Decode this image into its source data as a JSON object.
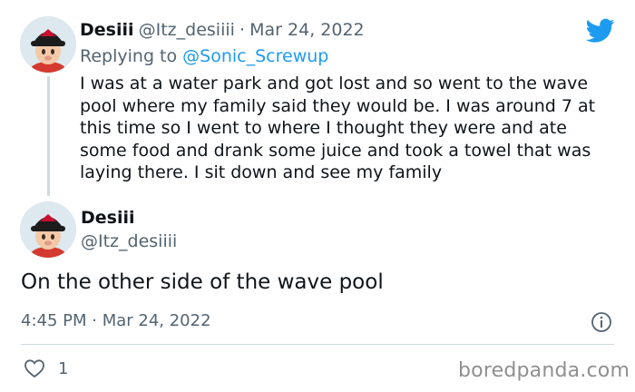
{
  "reply_tweet": {
    "display_name": "Desiii",
    "handle": "@Itz_desiiii",
    "separator": "·",
    "date": "Mar 24, 2022",
    "replying_prefix": "Replying to",
    "replying_to": "@Sonic_Screwup",
    "text": "I was at a water park and got lost and so went to the wave pool where my family said they would be. I was around 7 at this time so I went to where I thought they were and ate some food and drank some juice and took a towel that was laying there. I sit down and see my family"
  },
  "main_tweet": {
    "display_name": "Desiii",
    "handle": "@Itz_desiiii",
    "text": "On the other side of the wave pool",
    "timestamp": "4:45 PM · Mar 24, 2022",
    "like_count": "1"
  },
  "icons": {
    "brand": "twitter-bird-icon",
    "info": "info-icon",
    "like": "heart-icon"
  },
  "colors": {
    "twitter_blue": "#1d9bf0",
    "muted_text": "#536471",
    "avatar_cap_red": "#c8102e"
  },
  "watermark": "boredpanda.com"
}
